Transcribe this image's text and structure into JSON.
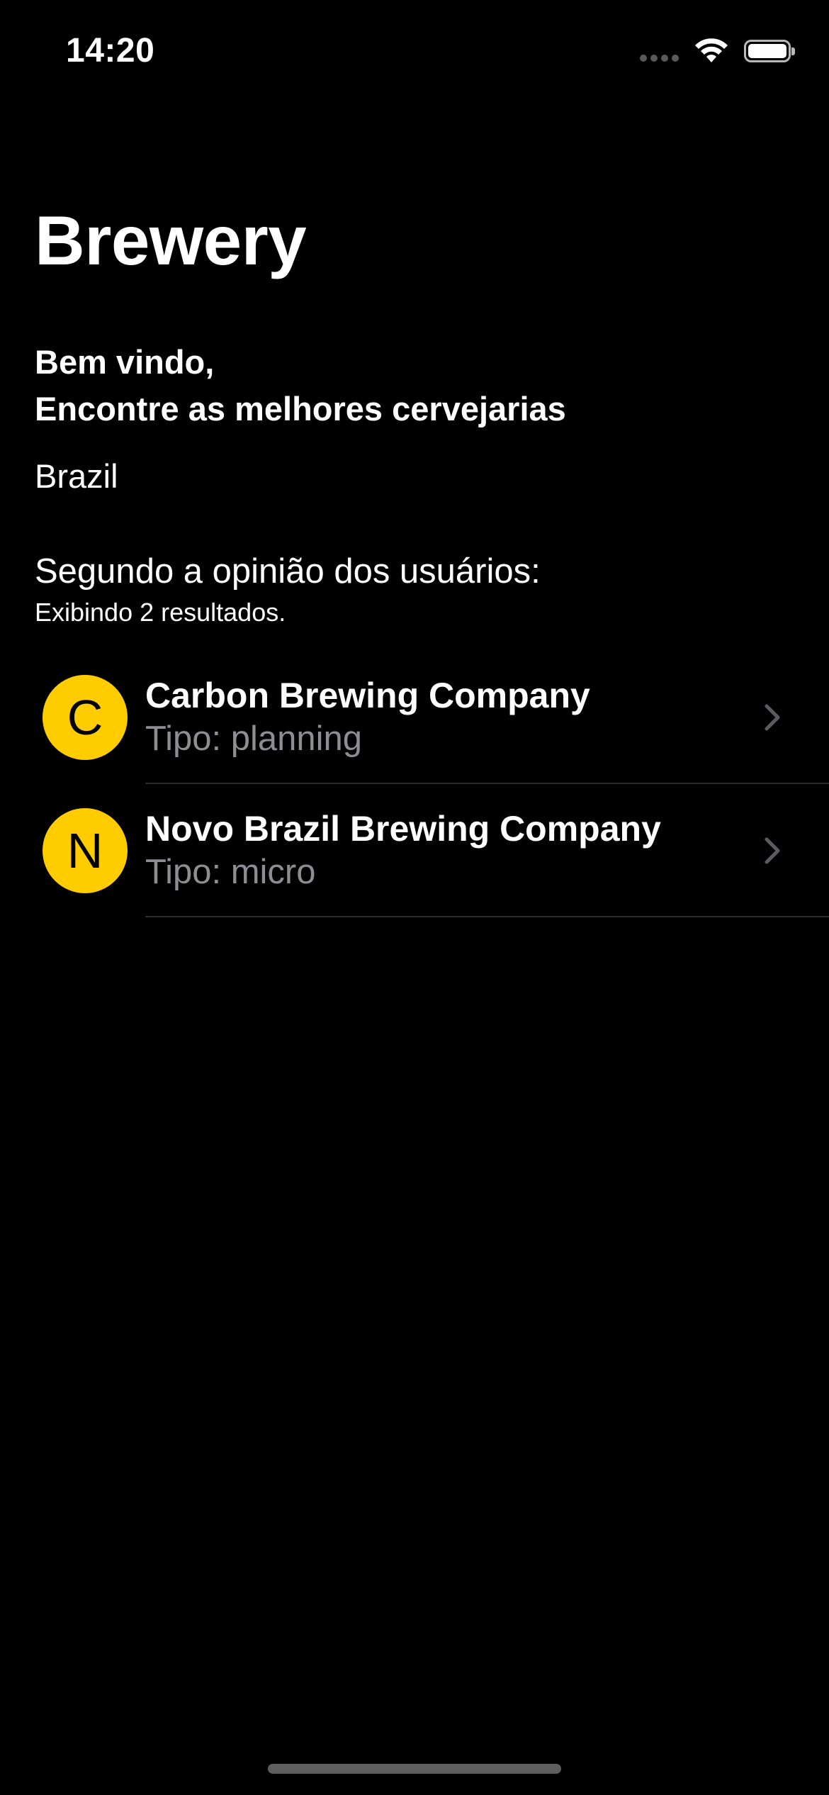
{
  "status_bar": {
    "time": "14:20"
  },
  "header": {
    "title": "Brewery",
    "welcome_line1": "Bem vindo,",
    "welcome_line2": "Encontre as melhores cervejarias",
    "country": "Brazil"
  },
  "section": {
    "title": "Segundo a opinião dos usuários:",
    "results_count": "Exibindo 2 resultados."
  },
  "breweries": [
    {
      "initial": "C",
      "name": "Carbon Brewing Company",
      "type": "Tipo: planning"
    },
    {
      "initial": "N",
      "name": "Novo Brazil Brewing Company",
      "type": "Tipo: micro"
    }
  ],
  "icons": {
    "signal": "cellular-signal-icon",
    "wifi": "wifi-icon",
    "battery": "battery-icon",
    "chevron": "chevron-right-icon"
  },
  "colors": {
    "background": "#000000",
    "accent": "#ffcc00",
    "secondary_text": "#8d8d93"
  }
}
